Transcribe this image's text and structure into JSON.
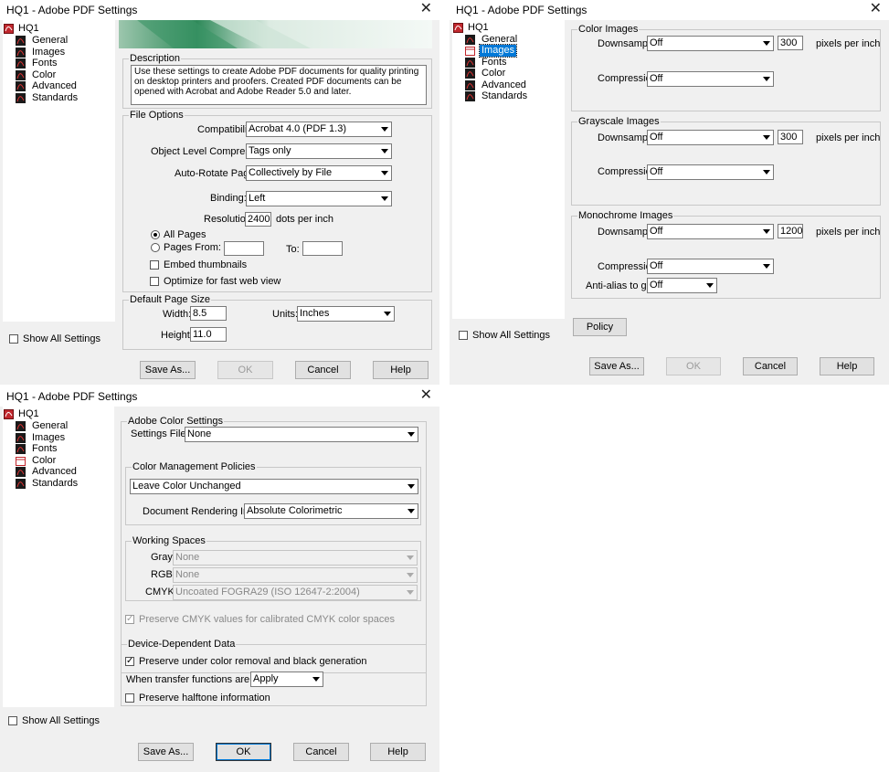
{
  "title": "HQ1 - Adobe PDF Settings",
  "close_glyph": "✕",
  "tree": {
    "root": "HQ1",
    "items": [
      "General",
      "Images",
      "Fonts",
      "Color",
      "Advanced",
      "Standards"
    ]
  },
  "show_all_settings": "Show All Settings",
  "buttons": {
    "save_as": "Save As...",
    "ok": "OK",
    "cancel": "Cancel",
    "help": "Help",
    "policy": "Policy"
  },
  "general": {
    "description_title": "Description",
    "description_text": "Use these settings to create Adobe PDF documents for quality printing on desktop printers and proofers.  Created PDF documents can be opened with Acrobat and Adobe Reader 5.0 and later.",
    "file_options_title": "File Options",
    "compatibility_label": "Compatibility:",
    "compatibility_value": "Acrobat 4.0 (PDF 1.3)",
    "object_compression_label": "Object Level Compression:",
    "object_compression_value": "Tags only",
    "auto_rotate_label": "Auto-Rotate Pages:",
    "auto_rotate_value": "Collectively by File",
    "binding_label": "Binding:",
    "binding_value": "Left",
    "resolution_label": "Resolution:",
    "resolution_value": "2400",
    "resolution_unit": "dots per inch",
    "all_pages": "All Pages",
    "pages_from": "Pages From:",
    "to_label": "To:",
    "embed_thumbnails": "Embed thumbnails",
    "optimize_web": "Optimize for fast web view",
    "page_size_title": "Default Page Size",
    "width_label": "Width:",
    "width_value": "8.5",
    "units_label": "Units:",
    "units_value": "Inches",
    "height_label": "Height:",
    "height_value": "11.0"
  },
  "images": {
    "color_title": "Color Images",
    "grayscale_title": "Grayscale Images",
    "mono_title": "Monochrome Images",
    "downsample_label": "Downsample:",
    "compression_label": "Compression:",
    "off": "Off",
    "color_ppi": "300",
    "gray_ppi": "300",
    "mono_ppi": "1200",
    "ppi_unit": "pixels per inch",
    "antialias_label": "Anti-alias to gray:"
  },
  "color": {
    "acs_title": "Adobe Color Settings",
    "settings_file_label": "Settings File:",
    "settings_file_value": "None",
    "cmp_title": "Color Management Policies",
    "policy_value": "Leave Color Unchanged",
    "intent_label": "Document Rendering Intent:",
    "intent_value": "Absolute Colorimetric",
    "ws_title": "Working Spaces",
    "gray_label": "Gray:",
    "gray_value": "None",
    "rgb_label": "RGB:",
    "rgb_value": "None",
    "cmyk_label": "CMYK:",
    "cmyk_value": "Uncoated FOGRA29 (ISO 12647-2:2004)",
    "preserve_cmyk": "Preserve CMYK values for calibrated CMYK color spaces",
    "ddd_title": "Device-Dependent Data",
    "preserve_ucr": "Preserve under color removal and black generation",
    "transfer_label": "When transfer functions are found:",
    "transfer_value": "Apply",
    "preserve_halftone": "Preserve halftone information"
  },
  "check_glyph": "✓",
  "colors": {
    "selection": "#0078d7",
    "pdf_red": "#c1272d",
    "banner_green": "#5aa27a"
  }
}
